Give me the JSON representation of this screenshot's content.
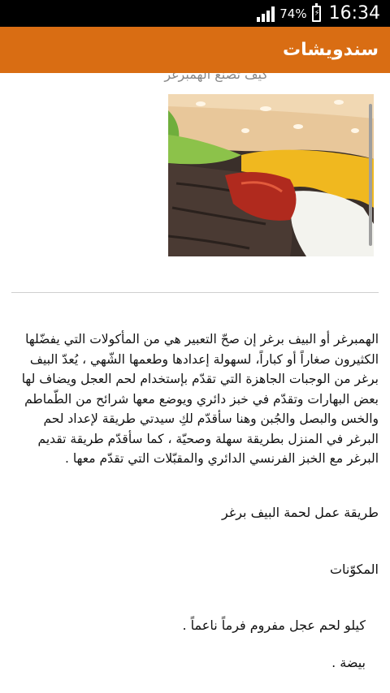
{
  "status_bar": {
    "battery_percent": "74%",
    "time": "16:34"
  },
  "app_bar": {
    "title": "سندويشات"
  },
  "article": {
    "cut_off_heading": "كيف تصنع الهمبرغر",
    "image_description_icon": "burger-photo",
    "intro": "الهمبرغر أو البيف برغر إن صحّ التعبير هي من المأكولات التي يفضّلها الكثيرون صغاراً أو كباراً، لسهولة إعدادها وطعمها الشّهي ، يُعدّ البيف برغر من الوجبات الجاهزة التي تقدّم بإستخدام لحم العجل ويضاف لها بعض البهارات وتقدّم في خبز دائري ويوضع معها شرائح من الطّماطم والخس والبصل والجُبن وهنا سأقدّم لكِ سيدتي طريقة لإعداد لحم البرغر في المنزل بطريقة سهلة وصحيّة ، كما سأقدّم طريقة تقديم البرغر مع الخبز الفرنسي الدائري والمقبّلات التي تقدّم معها .",
    "method_title": "طريقة عمل لحمة البيف برغر",
    "ingredients_title": "المكوّنات",
    "ingredients": [
      "كيلو لحم عجل مفروم فرماً ناعماً .",
      "بيضة ."
    ]
  },
  "colors": {
    "app_bar": "#d96d13",
    "status_bar": "#000000"
  }
}
